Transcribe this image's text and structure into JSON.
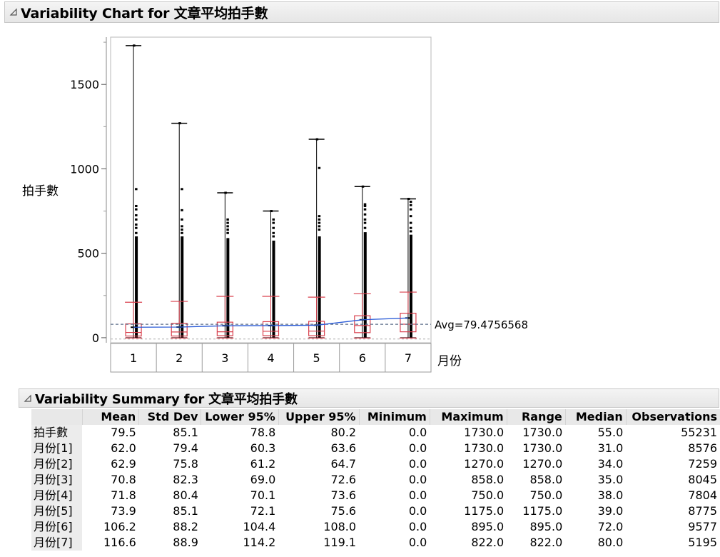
{
  "chart_title": "Variability Chart for 文章平均拍手數",
  "summary_title": "Variability Summary for 文章平均拍手數",
  "chart_data": {
    "type": "variability",
    "title": "Variability Chart for 文章平均拍手數",
    "ylabel": "拍手數",
    "xlabel": "月份",
    "ylim": [
      -30,
      1780
    ],
    "yticks": [
      0,
      500,
      1000,
      1500
    ],
    "categories": [
      "1",
      "2",
      "3",
      "4",
      "5",
      "6",
      "7"
    ],
    "grand_mean": 79.4756568,
    "avg_label": "Avg=79.4756568",
    "means": [
      62.0,
      62.9,
      70.8,
      71.8,
      73.9,
      106.2,
      116.6
    ],
    "medians": [
      31.0,
      34.0,
      35.0,
      38.0,
      39.0,
      72.0,
      80.0
    ],
    "minimums": [
      0,
      0,
      0,
      0,
      0,
      0,
      0
    ],
    "maximums": [
      1730,
      1270,
      858,
      750,
      1175,
      895,
      822
    ],
    "box_q1": [
      10,
      10,
      12,
      12,
      12,
      30,
      35
    ],
    "box_q3": [
      82,
      85,
      92,
      95,
      97,
      130,
      145
    ],
    "whisker_hi": [
      210,
      215,
      245,
      245,
      240,
      260,
      270
    ],
    "dense_top": [
      600,
      600,
      590,
      575,
      600,
      625,
      610
    ],
    "outliers": [
      [
        880,
        780,
        760,
        725,
        700,
        670,
        650,
        620
      ],
      [
        880,
        755,
        700,
        660,
        640,
        620
      ],
      [
        700,
        680,
        660,
        640,
        620
      ],
      [
        700,
        680,
        650,
        620,
        600
      ],
      [
        1005,
        720,
        700,
        680,
        660,
        640
      ],
      [
        790,
        780,
        760,
        730,
        700,
        680,
        650
      ],
      [
        805,
        785,
        760,
        720,
        680,
        650,
        630
      ]
    ],
    "colors": {
      "mean_line": "#2a5bd7",
      "box": "#d9414e",
      "avg_line": "#5c6e8a"
    }
  },
  "summary": {
    "columns": [
      "",
      "Mean",
      "Std Dev",
      "Lower 95%",
      "Upper 95%",
      "Minimum",
      "Maximum",
      "Range",
      "Median",
      "Observations"
    ],
    "rows": [
      [
        "拍手數",
        "79.5",
        "85.1",
        "78.8",
        "80.2",
        "0.0",
        "1730.0",
        "1730.0",
        "55.0",
        "55231"
      ],
      [
        "月份[1]",
        "62.0",
        "79.4",
        "60.3",
        "63.6",
        "0.0",
        "1730.0",
        "1730.0",
        "31.0",
        "8576"
      ],
      [
        "月份[2]",
        "62.9",
        "75.8",
        "61.2",
        "64.7",
        "0.0",
        "1270.0",
        "1270.0",
        "34.0",
        "7259"
      ],
      [
        "月份[3]",
        "70.8",
        "82.3",
        "69.0",
        "72.6",
        "0.0",
        "858.0",
        "858.0",
        "35.0",
        "8045"
      ],
      [
        "月份[4]",
        "71.8",
        "80.4",
        "70.1",
        "73.6",
        "0.0",
        "750.0",
        "750.0",
        "38.0",
        "7804"
      ],
      [
        "月份[5]",
        "73.9",
        "85.1",
        "72.1",
        "75.6",
        "0.0",
        "1175.0",
        "1175.0",
        "39.0",
        "8775"
      ],
      [
        "月份[6]",
        "106.2",
        "88.2",
        "104.4",
        "108.0",
        "0.0",
        "895.0",
        "895.0",
        "72.0",
        "9577"
      ],
      [
        "月份[7]",
        "116.6",
        "88.9",
        "114.2",
        "119.1",
        "0.0",
        "822.0",
        "822.0",
        "80.0",
        "5195"
      ]
    ]
  }
}
